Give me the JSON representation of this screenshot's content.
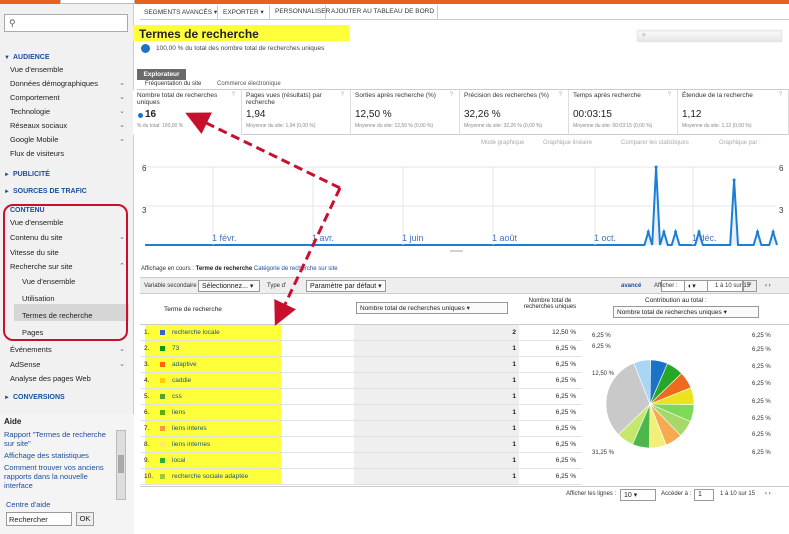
{
  "toolbar": {
    "segments": "SEGMENTS AVANCÉS",
    "export": "EXPORTER",
    "customize": "PERSONNALISER",
    "add_dashboard": "AJOUTER AU TABLEAU DE BORD"
  },
  "header": {
    "title": "Termes de recherche",
    "subtitle": "100,00 % du total des nombre total de recherches uniques"
  },
  "sidebar": {
    "search_placeholder": "",
    "sections": {
      "audience": "AUDIENCE",
      "publicite": "PUBLICITÉ",
      "sources": "SOURCES DE TRAFIC",
      "contenu": "CONTENU",
      "conversions": "CONVERSIONS"
    },
    "audience_items": [
      "Vue d'ensemble",
      "Données démographiques",
      "Comportement",
      "Technologie",
      "Réseaux sociaux",
      "Google Mobile",
      "Flux de visiteurs"
    ],
    "contenu_items": [
      "Vue d'ensemble",
      "Contenu du site",
      "Vitesse du site",
      "Recherche sur site"
    ],
    "recherche_items": [
      "Vue d'ensemble",
      "Utilisation",
      "Termes de recherche",
      "Pages"
    ],
    "after_items": [
      "Événements",
      "AdSense",
      "Analyse des pages Web"
    ],
    "aide": {
      "title": "Aide",
      "links": [
        "Rapport \"Termes de recherche sur site\"",
        "Affichage des statistiques",
        "Comment trouver vos anciens rapports dans la nouvelle interface"
      ],
      "centre": "Centre d'aide",
      "search_value": "Rechercher",
      "ok": "OK"
    }
  },
  "explorer": {
    "tab": "Explorateur",
    "subtabs": [
      "Fréquentation du site",
      "Commerce électronique"
    ]
  },
  "metrics": [
    {
      "label": "Nombre total de recherches uniques",
      "value": "16",
      "sub": "% du total: 100,00 %"
    },
    {
      "label": "Pages vues (résultats) par recherche",
      "value": "1,94",
      "sub": "Moyenne du site: 1,94 (0,00 %)"
    },
    {
      "label": "Sorties après recherche (%)",
      "value": "12,50 %",
      "sub": "Moyenne du site: 12,50 % (0,00 %)"
    },
    {
      "label": "Précision des recherches (%)",
      "value": "32,26 %",
      "sub": "Moyenne du site: 32,26 % (0,00 %)"
    },
    {
      "label": "Temps après recherche",
      "value": "00:03:15",
      "sub": "Moyenne du site: 00:03:15 (0,00 %)"
    },
    {
      "label": "Étendue de la recherche",
      "value": "1,12",
      "sub": "Moyenne du site: 1,12 (0,00 %)"
    }
  ],
  "chart_options": [
    "Mode graphique",
    "Graphique linéaire",
    "Comparer les statistiques",
    "Graphique par :"
  ],
  "chart_data": {
    "type": "line",
    "series": [
      {
        "name": "",
        "values": [
          0,
          0,
          0,
          0,
          0,
          0,
          0,
          0,
          0,
          0,
          0,
          0,
          0,
          0,
          0,
          0,
          0,
          0,
          0,
          0,
          0,
          0,
          0,
          0,
          0,
          0,
          0,
          0,
          0,
          0,
          0,
          0,
          0,
          0,
          0,
          0,
          0,
          0,
          0,
          0,
          0,
          0,
          0,
          0,
          0,
          0,
          0,
          0,
          0,
          0,
          0,
          0,
          0,
          0,
          0,
          0,
          0,
          0,
          0,
          0,
          0,
          0,
          0,
          0,
          0,
          0,
          0,
          0,
          0,
          0,
          0,
          0,
          0,
          0,
          0,
          0,
          0,
          0,
          0,
          0,
          0,
          0,
          0,
          0,
          0,
          0,
          0,
          0,
          0,
          0,
          0,
          0,
          0,
          0,
          0,
          0,
          0,
          0,
          0,
          0,
          0,
          0,
          0,
          0,
          0,
          0,
          0,
          0,
          0,
          0,
          0,
          0,
          0,
          0,
          0,
          0,
          0,
          0,
          0,
          0,
          0,
          0,
          0,
          0,
          0,
          0,
          0,
          0,
          0,
          1,
          0,
          6,
          0,
          1,
          0,
          0,
          1,
          0,
          0,
          0,
          0,
          0,
          1,
          0,
          0,
          0,
          0,
          0,
          0,
          0,
          0,
          5,
          0,
          0,
          0,
          0,
          0,
          1,
          0,
          0,
          0,
          1,
          0
        ]
      }
    ],
    "x_ticks": [
      "1 févr.",
      "1 avr.",
      "1 juin",
      "1 août",
      "1 oct.",
      "1 déc."
    ],
    "y_ticks": [
      "6",
      "3"
    ],
    "ylim": [
      0,
      6
    ]
  },
  "table": {
    "context_prefix": "Affichage en cours :",
    "context_current": "Terme de recherche",
    "context_link": "Catégorie de recherche sur site",
    "secondary_label": "Variable secondaire :",
    "secondary_value": "Sélectionnez...",
    "type_label": "Type d'",
    "type_value": "Paramètre par défaut",
    "advanced": "avancé",
    "display_label": "Afficher :",
    "range": "1 à 10 sur 15",
    "col_term": "Terme de recherche",
    "col_metric": "Nombre total de recherches uniques",
    "col_metric_h": "Nombre total de recherches uniques",
    "col_contrib": "Contribution au total :",
    "col_contrib_value": "Nombre total de recherches uniques",
    "rows": [
      {
        "n": "1.",
        "term": "recherche locale",
        "value": "2",
        "pct": "12,50 %",
        "color": "#3366cc"
      },
      {
        "n": "2.",
        "term": "73",
        "value": "1",
        "pct": "6,25 %",
        "color": "#109618"
      },
      {
        "n": "3.",
        "term": "adaptive",
        "value": "1",
        "pct": "6,25 %",
        "color": "#ff6600"
      },
      {
        "n": "4.",
        "term": "caddie",
        "value": "1",
        "pct": "6,25 %",
        "color": "#ffcc00"
      },
      {
        "n": "5.",
        "term": "css",
        "value": "1",
        "pct": "6,25 %",
        "color": "#5aa02c"
      },
      {
        "n": "6.",
        "term": "liens",
        "value": "1",
        "pct": "6,25 %",
        "color": "#66aa00"
      },
      {
        "n": "7.",
        "term": "liens interes",
        "value": "1",
        "pct": "6,25 %",
        "color": "#ff9933"
      },
      {
        "n": "8.",
        "term": "liens internes",
        "value": "1",
        "pct": "6,25 %",
        "color": "#ffee55"
      },
      {
        "n": "9.",
        "term": "local",
        "value": "1",
        "pct": "6,25 %",
        "color": "#33aa33"
      },
      {
        "n": "10.",
        "term": "recherche sociale adaptée",
        "value": "1",
        "pct": "6,25 %",
        "color": "#99cc33"
      }
    ],
    "pie_labels": [
      "6,25 %",
      "6,25 %",
      "12,50 %",
      "31,25 %",
      "6,25 %",
      "6,25 %",
      "6,25 %",
      "6,25 %",
      "6,25 %",
      "6,25 %",
      "6,25 %",
      "6,25 %"
    ],
    "footer": {
      "rows_label": "Afficher les lignes :",
      "rows_value": "10",
      "goto_label": "Accéder à :",
      "goto_value": "1",
      "range": "1 à 10 sur 15"
    }
  }
}
